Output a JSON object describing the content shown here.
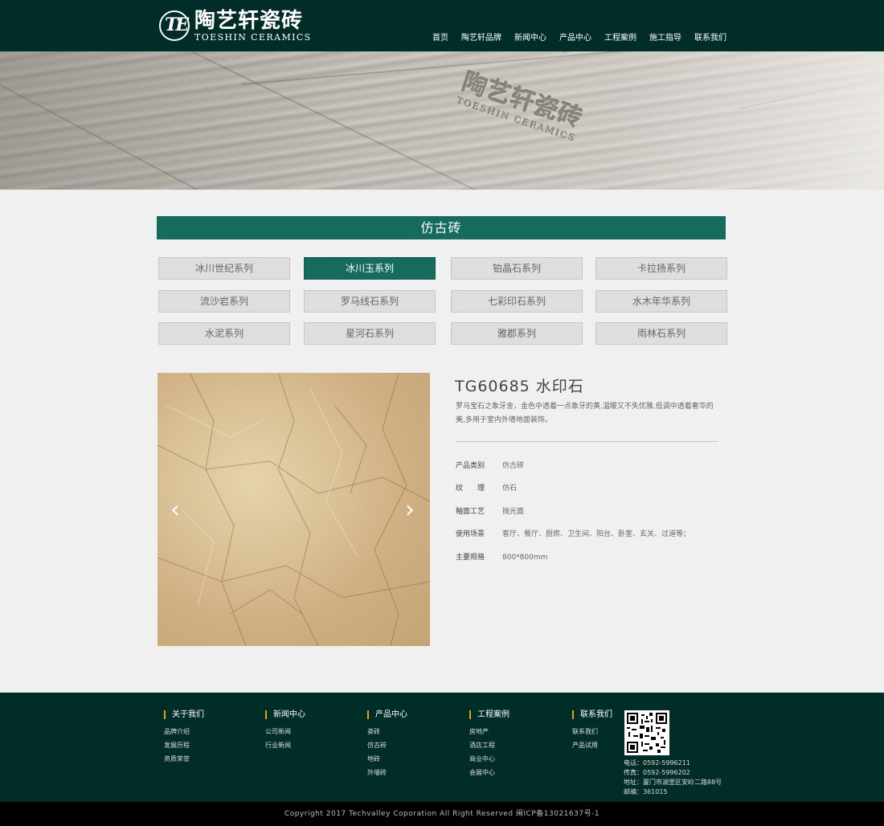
{
  "brand": {
    "mark": "TE",
    "name_cn": "陶艺轩瓷砖",
    "name_en": "TOESHIN CERAMICS"
  },
  "nav": [
    "首页",
    "陶艺轩品牌",
    "新闻中心",
    "产品中心",
    "工程案例",
    "施工指导",
    "联系我们"
  ],
  "banner": {
    "emboss_cn": "陶艺轩瓷砖",
    "emboss_en": "TOESHIN CERAMICS"
  },
  "section_title": "仿古砖",
  "series": [
    {
      "label": "冰川世纪系列",
      "active": false
    },
    {
      "label": "冰川玉系列",
      "active": true
    },
    {
      "label": "铂晶石系列",
      "active": false
    },
    {
      "label": "卡拉扬系列",
      "active": false
    },
    {
      "label": "流沙岩系列",
      "active": false
    },
    {
      "label": "罗马线石系列",
      "active": false
    },
    {
      "label": "七彩印石系列",
      "active": false
    },
    {
      "label": "水木年华系列",
      "active": false
    },
    {
      "label": "水泥系列",
      "active": false
    },
    {
      "label": "星河石系列",
      "active": false
    },
    {
      "label": "雅郡系列",
      "active": false
    },
    {
      "label": "雨林石系列",
      "active": false
    }
  ],
  "product": {
    "title": "TG60685 水印石",
    "description": "罗马宝石之象牙舍，金色中透着一点象牙的黄,温暖又不失优雅,低调中透着奢华的美,多用于室内外墙地面装饰。",
    "specs": [
      {
        "key": "产品类别",
        "value": "仿古砖"
      },
      {
        "key": "纹　　理",
        "value": "仿石"
      },
      {
        "key": "釉面工艺",
        "value": "抛光面"
      },
      {
        "key": "使用场景",
        "value": "客厅、餐厅、厨房、卫生间、阳台、卧室、玄关、过道等；"
      },
      {
        "key": "主要规格",
        "value": "800*800mm"
      }
    ],
    "prev_arrow": "‹",
    "next_arrow": "›"
  },
  "footer": {
    "columns": [
      {
        "title": "关于我们",
        "links": [
          "品牌介绍",
          "发展历程",
          "资质荣誉"
        ]
      },
      {
        "title": "新闻中心",
        "links": [
          "公司新闻",
          "行业新闻"
        ]
      },
      {
        "title": "产品中心",
        "links": [
          "瓷砖",
          "仿古砖",
          "地砖",
          "外墙砖"
        ]
      },
      {
        "title": "工程案例",
        "links": [
          "房地产",
          "酒店工程",
          "商业中心",
          "会展中心"
        ]
      },
      {
        "title": "联系我们",
        "links": [
          "联系我们",
          "产品试用"
        ]
      }
    ],
    "contact": [
      "电话：0592-5996211",
      "传真：0592-5996202",
      "地址：厦门市湖里区安岭二路88号",
      "邮编：361015"
    ],
    "copyright": "Copyright 2017 Techvalley Coporation All Right Reserved 闽ICP备13021637号-1"
  },
  "colors": {
    "header_bg": "#002d27",
    "accent": "#146b5e",
    "footer_marker": "#e2a400"
  }
}
